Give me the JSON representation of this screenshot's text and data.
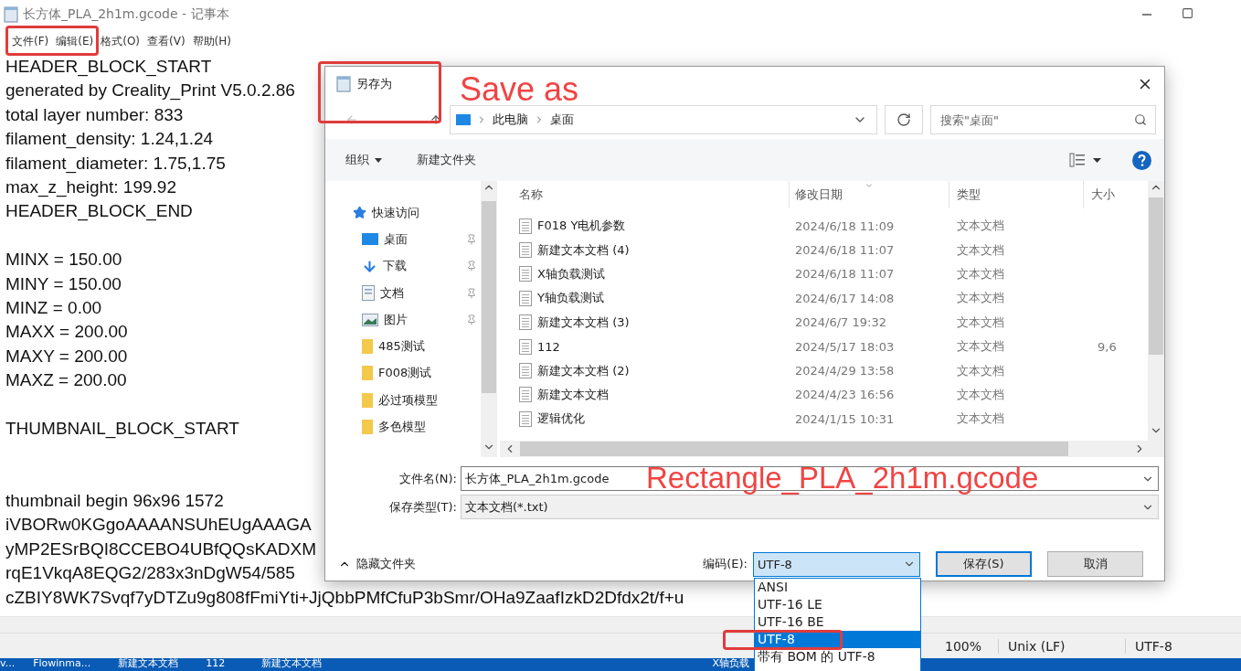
{
  "notepad": {
    "title": "长方体_PLA_2h1m.gcode - 记事本",
    "menu": [
      "文件(F)",
      "编辑(E)",
      "格式(O)",
      "查看(V)",
      "帮助(H)"
    ],
    "lines": [
      {
        "kind": "text",
        "text": "HEADER_BLOCK_START"
      },
      {
        "kind": "text",
        "text": "generated by Creality_Print V5.0.2.86"
      },
      {
        "kind": "text",
        "text": "total layer number: 833"
      },
      {
        "kind": "text",
        "text": "filament_density: 1.24,1.24"
      },
      {
        "kind": "text",
        "text": "filament_diameter: 1.75,1.75"
      },
      {
        "kind": "text",
        "text": "max_z_height: 199.92"
      },
      {
        "kind": "text",
        "text": "HEADER_BLOCK_END"
      },
      {
        "kind": "blank"
      },
      {
        "kind": "text",
        "text": "MINX = 150.00"
      },
      {
        "kind": "text",
        "text": "MINY = 150.00"
      },
      {
        "kind": "text",
        "text": "MINZ = 0.00"
      },
      {
        "kind": "text",
        "text": "MAXX = 200.00"
      },
      {
        "kind": "text",
        "text": "MAXY = 200.00"
      },
      {
        "kind": "text",
        "text": "MAXZ = 200.00"
      },
      {
        "kind": "blank"
      },
      {
        "kind": "text",
        "text": "THUMBNAIL_BLOCK_START"
      },
      {
        "kind": "blank"
      },
      {
        "kind": "blank"
      },
      {
        "kind": "text",
        "text": "thumbnail begin 96x96 1572"
      },
      {
        "kind": "text",
        "text": "iVBORw0KGgoAAAANSUhEUgAAAGA"
      },
      {
        "kind": "text",
        "text": "yMP2ESrBQI8CCEBO4UBfQQsKADXM"
      },
      {
        "kind": "text",
        "text": "rqE1VkqA8EQG2/283x3nDgW54/585"
      },
      {
        "kind": "text",
        "text": "cZBIY8WK7Svqf7yDTZu9g808fFmiYti+JjQbbPMfCfuP3bSmr/OHa9ZaafIzkD2Dfdx2t/f+u"
      }
    ],
    "status_bar": [
      "100%",
      "Unix (LF)",
      "UTF-8"
    ]
  },
  "taskbar": {
    "items": [
      "v...",
      "Flowinma...",
      "新建文本文档",
      "112",
      "新建文本文档",
      "X轴负载"
    ]
  },
  "dialog": {
    "title": "另存为",
    "breadcrumb": [
      "此电脑",
      "桌面"
    ],
    "search_placeholder": "搜索\"桌面\"",
    "toolbar": {
      "organize": "组织",
      "new_folder": "新建文件夹"
    },
    "nav": [
      {
        "kind": "quick",
        "label": "快速访问",
        "pinned": false
      },
      {
        "kind": "desktop",
        "label": "桌面",
        "pinned": true
      },
      {
        "kind": "download",
        "label": "下载",
        "pinned": true
      },
      {
        "kind": "docs",
        "label": "文档",
        "pinned": true
      },
      {
        "kind": "pictures",
        "label": "图片",
        "pinned": true
      },
      {
        "kind": "folder",
        "label": "485测试",
        "pinned": false
      },
      {
        "kind": "folder",
        "label": "F008测试",
        "pinned": false
      },
      {
        "kind": "folder",
        "label": "必过项模型",
        "pinned": false
      },
      {
        "kind": "folder",
        "label": "多色模型",
        "pinned": false
      }
    ],
    "columns": [
      {
        "label": "名称",
        "sorted": false
      },
      {
        "label": "修改日期",
        "sorted": true
      },
      {
        "label": "类型",
        "sorted": false
      },
      {
        "label": "大小",
        "sorted": false
      }
    ],
    "rows": [
      {
        "name": "F018 Y电机参数",
        "date": "2024/6/18 11:09",
        "type": "文本文档"
      },
      {
        "name": "新建文本文档 (4)",
        "date": "2024/6/18 11:07",
        "type": "文本文档"
      },
      {
        "name": "X轴负载测试",
        "date": "2024/6/18 11:07",
        "type": "文本文档"
      },
      {
        "name": "Y轴负载测试",
        "date": "2024/6/17 14:08",
        "type": "文本文档"
      },
      {
        "name": "新建文本文档 (3)",
        "date": "2024/6/7 19:32",
        "type": "文本文档"
      },
      {
        "name": "112",
        "date": "2024/5/17 18:03",
        "type": "文本文档",
        "size": "9,6"
      },
      {
        "name": "新建文本文档 (2)",
        "date": "2024/4/29 13:58",
        "type": "文本文档"
      },
      {
        "name": "新建文本文档",
        "date": "2024/4/23 16:56",
        "type": "文本文档"
      },
      {
        "name": "逻辑优化",
        "date": "2024/1/15 10:31",
        "type": "文本文档"
      }
    ],
    "filename_label": "文件名(N):",
    "filename": "长方体_PLA_2h1m.gcode",
    "type_label": "保存类型(T):",
    "type_value": "文本文档(*.txt)",
    "hide_folders": "隐藏文件夹",
    "encoding_label": "编码(E):",
    "encoding_value": "UTF-8",
    "buttons": [
      {
        "label": "保存(S)",
        "default": true
      },
      {
        "label": "取消",
        "default": false
      }
    ],
    "encoding_options": [
      {
        "label": "ANSI",
        "selected": false
      },
      {
        "label": "UTF-16 LE",
        "selected": false
      },
      {
        "label": "UTF-16 BE",
        "selected": false
      },
      {
        "label": "UTF-8",
        "selected": true
      },
      {
        "label": "带有 BOM 的 UTF-8",
        "selected": false
      }
    ]
  },
  "annotations": [
    {
      "kind": "box"
    },
    {
      "kind": "box"
    },
    {
      "kind": "text",
      "text": "Save as"
    },
    {
      "kind": "text",
      "text": "Rectangle_PLA_2h1m.gcode"
    },
    {
      "kind": "box"
    }
  ]
}
